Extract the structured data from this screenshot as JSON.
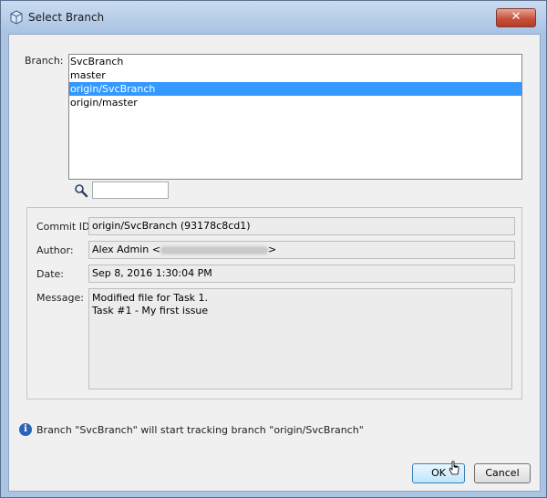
{
  "window": {
    "title": "Select Branch",
    "close_label": "✕"
  },
  "branch": {
    "label": "Branch:",
    "items": [
      "SvcBranch",
      "master",
      "origin/SvcBranch",
      "origin/master"
    ],
    "selected_index": 2,
    "search_value": ""
  },
  "details": {
    "commit_label": "Commit ID:",
    "commit_value": "origin/SvcBranch (93178c8cd1)",
    "author_label": "Author:",
    "author_name": "Alex Admin <",
    "author_close": ">",
    "date_label": "Date:",
    "date_value": "Sep 8, 2016 1:30:04 PM",
    "message_label": "Message:",
    "message_lines": [
      "Modified file for Task 1.",
      "Task #1 - My first issue"
    ]
  },
  "info": {
    "text": "Branch \"SvcBranch\" will start tracking branch \"origin/SvcBranch\"",
    "icon": "i"
  },
  "buttons": {
    "ok": "OK",
    "cancel": "Cancel"
  },
  "colors": {
    "selection": "#3399ff",
    "titlebar": "#b9d1ea",
    "close": "#c7523b"
  }
}
